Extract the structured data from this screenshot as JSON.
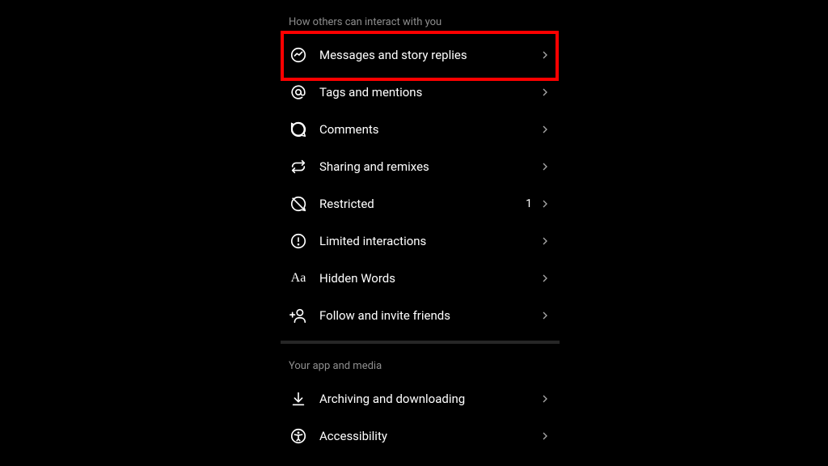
{
  "sections": {
    "interact": {
      "title": "How others can interact with you",
      "items": [
        {
          "label": "Messages and story replies",
          "icon": "messenger"
        },
        {
          "label": "Tags and mentions",
          "icon": "at"
        },
        {
          "label": "Comments",
          "icon": "comment"
        },
        {
          "label": "Sharing and remixes",
          "icon": "share"
        },
        {
          "label": "Restricted",
          "icon": "restricted",
          "badge": "1"
        },
        {
          "label": "Limited interactions",
          "icon": "limited"
        },
        {
          "label": "Hidden Words",
          "icon": "aa"
        },
        {
          "label": "Follow and invite friends",
          "icon": "follow"
        }
      ]
    },
    "appmedia": {
      "title": "Your app and media",
      "items": [
        {
          "label": "Archiving and downloading",
          "icon": "archive"
        },
        {
          "label": "Accessibility",
          "icon": "accessibility"
        }
      ]
    }
  }
}
